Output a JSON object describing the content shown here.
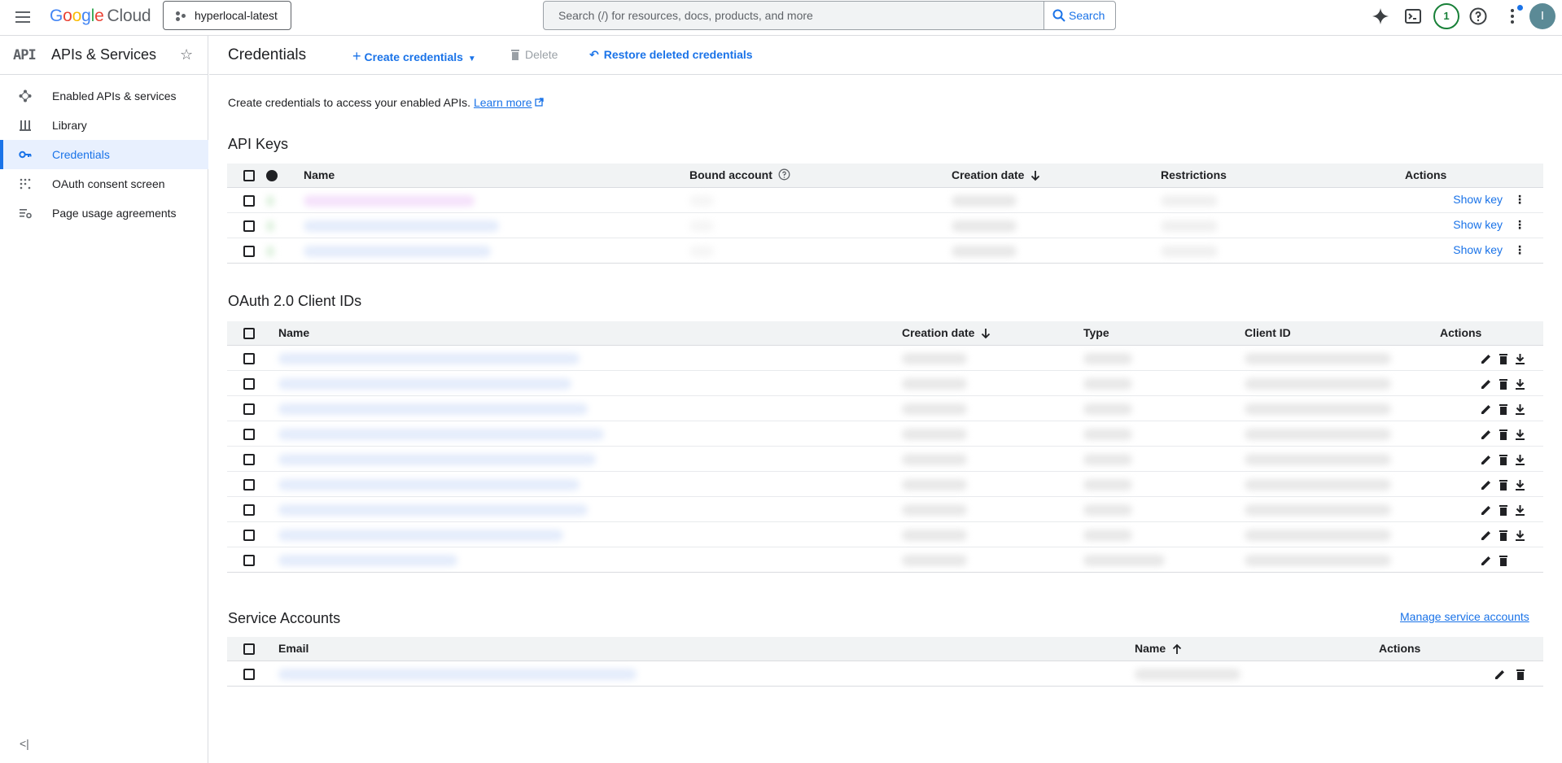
{
  "topbar": {
    "brand_google": "Google",
    "brand_cloud": "Cloud",
    "project": "hyperlocal-latest",
    "search_placeholder": "Search (/) for resources, docs, products, and more",
    "search_button": "Search",
    "notification_count": "1",
    "avatar_letter": "I"
  },
  "sidebar": {
    "title": "APIs & Services",
    "badge": "API",
    "items": [
      {
        "label": "Enabled APIs & services",
        "icon": "diamond-nodes-icon"
      },
      {
        "label": "Library",
        "icon": "library-icon"
      },
      {
        "label": "Credentials",
        "icon": "key-icon"
      },
      {
        "label": "OAuth consent screen",
        "icon": "dots-grid-icon"
      },
      {
        "label": "Page usage agreements",
        "icon": "settings-list-icon"
      }
    ],
    "collapse": "<|"
  },
  "main": {
    "title": "Credentials",
    "create_label": "Create credentials",
    "delete_label": "Delete",
    "restore_label": "Restore deleted credentials",
    "intro_text": "Create credentials to access your enabled APIs.",
    "learn_more": "Learn more"
  },
  "api_keys": {
    "title": "API Keys",
    "columns": {
      "name": "Name",
      "bound": "Bound account",
      "created": "Creation date",
      "restrictions": "Restrictions",
      "actions": "Actions"
    },
    "show_key": "Show key",
    "row_count": 3
  },
  "oauth": {
    "title": "OAuth 2.0 Client IDs",
    "columns": {
      "name": "Name",
      "created": "Creation date",
      "type": "Type",
      "client_id": "Client ID",
      "actions": "Actions"
    },
    "row_count": 9
  },
  "service_accounts": {
    "title": "Service Accounts",
    "manage_link": "Manage service accounts",
    "columns": {
      "email": "Email",
      "name": "Name",
      "actions": "Actions"
    }
  },
  "colors": {
    "accent": "#1a73e8",
    "header_bg": "#f1f3f4",
    "active_bg": "#e8f0fe"
  }
}
